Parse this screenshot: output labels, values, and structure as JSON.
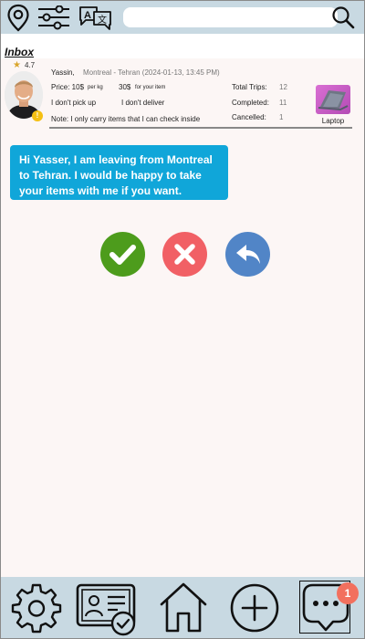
{
  "header": {
    "search": {
      "value": "",
      "placeholder": ""
    }
  },
  "inbox": {
    "title": "Inbox"
  },
  "card": {
    "rating": "4.7",
    "traveler_name": "Yassin,",
    "route": "Montreal - Tehran (2024-01-13, 13:45 PM)",
    "price_label": "Price: 10$",
    "price_unit": "per kg",
    "item_price": "30$",
    "item_price_unit": "for your item",
    "pickup": "I don't pick up",
    "delivery": "I don't deliver",
    "note": "Note: I only carry items that I can check inside",
    "stats": [
      {
        "label": "Total Trips:",
        "value": "12"
      },
      {
        "label": "Completed:",
        "value": "11"
      },
      {
        "label": "Cancelled:",
        "value": "1"
      }
    ],
    "item_label": "Laptop",
    "verified_badge": "!"
  },
  "message": {
    "text": "Hi Yasser,  I am leaving from Montreal to Tehran. I would be happy to take your items with me if you want."
  },
  "bottom_nav": {
    "chat_badge": "1"
  },
  "colors": {
    "topbar": "#c8d9e2",
    "bubble": "#10a6d9",
    "accept": "#4d9c1c",
    "reject": "#f16065",
    "reply": "#5185c7",
    "badge": "#f2705e"
  }
}
